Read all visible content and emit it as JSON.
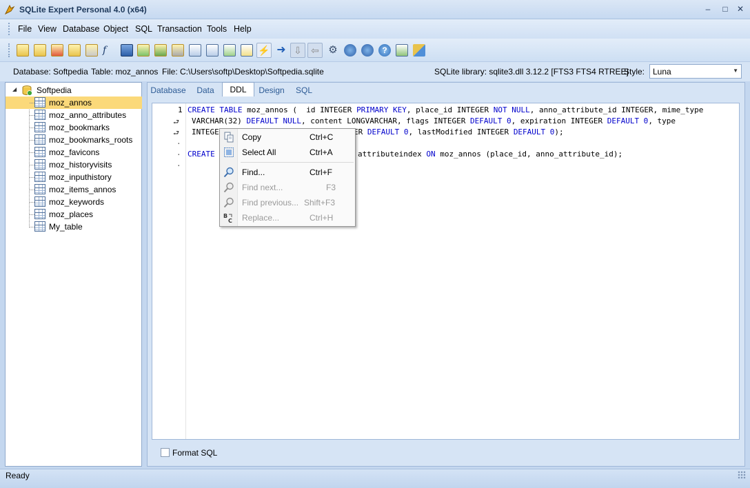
{
  "window": {
    "title": "SQLite Expert Personal 4.0 (x64)",
    "minimize": "–",
    "maximize": "□",
    "close": "✕"
  },
  "menu": [
    "File",
    "View",
    "Database",
    "Object",
    "SQL",
    "Transaction",
    "Tools",
    "Help"
  ],
  "toolbar_icons": [
    "new-database-icon",
    "open-database-icon",
    "close-database-icon",
    "edit-database-icon",
    "attach-database-icon",
    "new-function-icon",
    "backup-icon",
    "refresh-icon",
    "import-icon",
    "settings-icon",
    "new-table-icon",
    "new-view-icon",
    "design-table-icon",
    "new-trigger-icon",
    "execute-icon",
    "next-icon",
    "move-down-icon",
    "move-left-icon",
    "options-icon",
    "script-icon",
    "load-extension-icon",
    "help-icon",
    "console-icon",
    "tools-icon"
  ],
  "infobar": {
    "database": "Database: Softpedia",
    "table": "Table: moz_annos",
    "file": "File: C:\\Users\\softp\\Desktop\\Softpedia.sqlite",
    "library": "SQLite library: sqlite3.dll 3.12.2 [FTS3 FTS4 RTREE]",
    "style_label": "Style:",
    "style_value": "Luna"
  },
  "tree": {
    "root": "Softpedia",
    "items": [
      "moz_annos",
      "moz_anno_attributes",
      "moz_bookmarks",
      "moz_bookmarks_roots",
      "moz_favicons",
      "moz_historyvisits",
      "moz_inputhistory",
      "moz_items_annos",
      "moz_keywords",
      "moz_places",
      "My_table"
    ],
    "selected": "moz_annos"
  },
  "tabs": [
    "Database",
    "Data",
    "DDL",
    "Design",
    "SQL"
  ],
  "active_tab": "DDL",
  "editor": {
    "line_number": "1",
    "line1": [
      {
        "t": "CREATE TABLE",
        "k": true
      },
      {
        "t": " moz_annos (  id INTEGER ",
        "k": false
      },
      {
        "t": "PRIMARY KEY",
        "k": true
      },
      {
        "t": ", place_id INTEGER ",
        "k": false
      },
      {
        "t": "NOT NULL",
        "k": true
      },
      {
        "t": ", anno_attribute_id INTEGER, mime_type",
        "k": false
      }
    ],
    "line2": [
      {
        "t": "VARCHAR(32) ",
        "k": false
      },
      {
        "t": "DEFAULT NULL",
        "k": true
      },
      {
        "t": ", content LONGVARCHAR, flags INTEGER ",
        "k": false
      },
      {
        "t": "DEFAULT 0",
        "k": true
      },
      {
        "t": ", expiration INTEGER ",
        "k": false
      },
      {
        "t": "DEFAULT 0",
        "k": true
      },
      {
        "t": ", type",
        "k": false
      }
    ],
    "line3_start": "INTEGE",
    "line3_end": [
      {
        "t": "ER ",
        "k": false
      },
      {
        "t": "DEFAULT 0",
        "k": true
      },
      {
        "t": ", lastModified INTEGER ",
        "k": false
      },
      {
        "t": "DEFAULT 0",
        "k": true
      },
      {
        "t": ");",
        "k": false
      }
    ],
    "line4_start": "CREATE",
    "line4_end": [
      {
        "t": "attributeindex ",
        "k": false
      },
      {
        "t": "ON",
        "k": true
      },
      {
        "t": " moz_annos (place_id, anno_attribute_id);",
        "k": false
      }
    ],
    "format_sql": "Format SQL"
  },
  "context_menu": [
    {
      "label": "Copy",
      "shortcut": "Ctrl+C",
      "icon": "copy-icon",
      "enabled": true
    },
    {
      "label": "Select All",
      "shortcut": "Ctrl+A",
      "icon": "select-all-icon",
      "enabled": true
    },
    {
      "label": "Find...",
      "shortcut": "Ctrl+F",
      "icon": "find-icon",
      "enabled": true
    },
    {
      "label": "Find next...",
      "shortcut": "F3",
      "icon": "find-next-icon",
      "enabled": false
    },
    {
      "label": "Find previous...",
      "shortcut": "Shift+F3",
      "icon": "find-previous-icon",
      "enabled": false
    },
    {
      "label": "Replace...",
      "shortcut": "Ctrl+H",
      "icon": "replace-icon",
      "enabled": false
    }
  ],
  "status": "Ready",
  "colors": {
    "keyword": "#0000cc",
    "selection": "#fbd97a",
    "frame": "#c4d7ef"
  }
}
